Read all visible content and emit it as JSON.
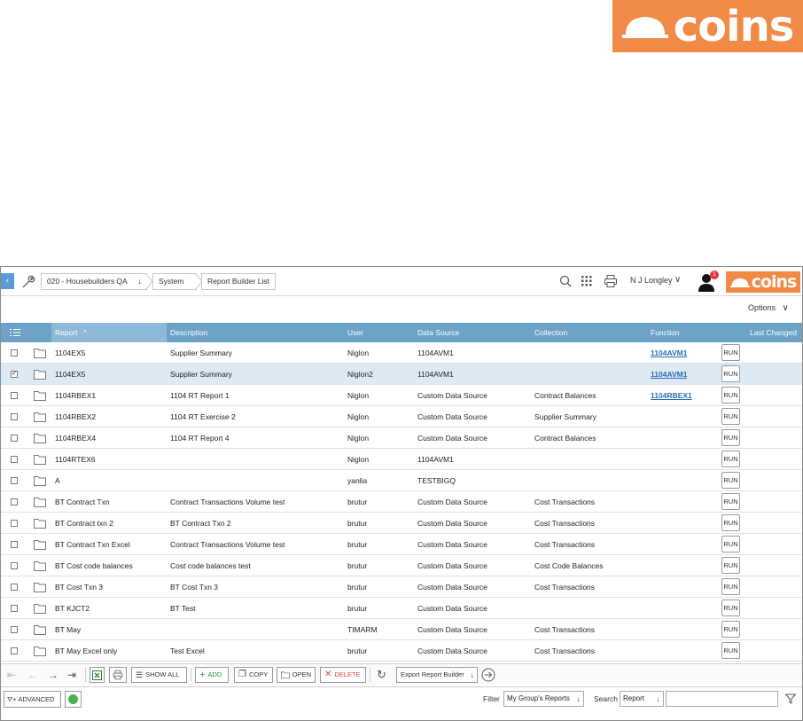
{
  "colors": {
    "brand": "#f08a46",
    "header_bar": "#6ea3c9",
    "selected_row": "#dde9f3",
    "link": "#2a6fb0"
  },
  "brand": {
    "logo_text": "coins"
  },
  "header": {
    "breadcrumbs": [
      "020 - Housebuilders QA",
      "System",
      "Report Builder List"
    ],
    "user_name": "N J Longley",
    "notification_count": "1",
    "icons": [
      "wrench-icon",
      "search-icon",
      "grid-icon",
      "print-icon",
      "user-icon"
    ]
  },
  "options_label": "Options",
  "table": {
    "columns": [
      "Report",
      "Description",
      "User",
      "Data Source",
      "Collection",
      "Function",
      "Last Changed"
    ],
    "sort_indicator": "^",
    "rows": [
      {
        "checked": false,
        "report": "1104EX5",
        "description": "Supplier Summary",
        "user": "Niglon",
        "data_source": "1104AVM1",
        "collection": "",
        "function": "1104AVM1",
        "last_changed": ""
      },
      {
        "checked": true,
        "report": "1104EX5",
        "description": "Supplier Summary",
        "user": "Niglon2",
        "data_source": "1104AVM1",
        "collection": "",
        "function": "1104AVM1",
        "last_changed": ""
      },
      {
        "checked": false,
        "report": "1104RBEX1",
        "description": "1104 RT Report 1",
        "user": "Niglon",
        "data_source": "Custom Data Source",
        "collection": "Contract Balances",
        "function": "1104RBEX1",
        "last_changed": ""
      },
      {
        "checked": false,
        "report": "1104RBEX2",
        "description": "1104 RT Exercise 2",
        "user": "Niglon",
        "data_source": "Custom Data Source",
        "collection": "Supplier Summary",
        "function": "",
        "last_changed": ""
      },
      {
        "checked": false,
        "report": "1104RBEX4",
        "description": "1104 RT Report 4",
        "user": "Niglon",
        "data_source": "Custom Data Source",
        "collection": "Contract Balances",
        "function": "",
        "last_changed": ""
      },
      {
        "checked": false,
        "report": "1104RTEX6",
        "description": "",
        "user": "Niglon",
        "data_source": "1104AVM1",
        "collection": "",
        "function": "",
        "last_changed": ""
      },
      {
        "checked": false,
        "report": "A",
        "description": "",
        "user": "yanlia",
        "data_source": "TESTBIGQ",
        "collection": "",
        "function": "",
        "last_changed": ""
      },
      {
        "checked": false,
        "report": "BT Contract Txn",
        "description": "Contract Transactions Volume test",
        "user": "brutur",
        "data_source": "Custom Data Source",
        "collection": "Cost Transactions",
        "function": "",
        "last_changed": ""
      },
      {
        "checked": false,
        "report": "BT Contract txn 2",
        "description": "BT Contract Txn 2",
        "user": "brutur",
        "data_source": "Custom Data Source",
        "collection": "Cost Transactions",
        "function": "",
        "last_changed": ""
      },
      {
        "checked": false,
        "report": "BT Contract Txn Excel",
        "description": "Contract Transactions Volume test",
        "user": "brutur",
        "data_source": "Custom Data Source",
        "collection": "Cost Transactions",
        "function": "",
        "last_changed": ""
      },
      {
        "checked": false,
        "report": "BT Cost code balances",
        "description": "Cost code balances test",
        "user": "brutur",
        "data_source": "Custom Data Source",
        "collection": "Cost Code Balances",
        "function": "",
        "last_changed": ""
      },
      {
        "checked": false,
        "report": "BT Cost Txn 3",
        "description": "BT Cost Txn 3",
        "user": "brutur",
        "data_source": "Custom Data Source",
        "collection": "Cost Transactions",
        "function": "",
        "last_changed": ""
      },
      {
        "checked": false,
        "report": "BT KJCT2",
        "description": "BT Test",
        "user": "brutur",
        "data_source": "Custom Data Source",
        "collection": "",
        "function": "",
        "last_changed": ""
      },
      {
        "checked": false,
        "report": "BT May",
        "description": "",
        "user": "TIMARM",
        "data_source": "Custom Data Source",
        "collection": "Cost Transactions",
        "function": "",
        "last_changed": ""
      },
      {
        "checked": false,
        "report": "BT May Excel only",
        "description": "Test Excel",
        "user": "brutur",
        "data_source": "Custom Data Source",
        "collection": "Cost Transactions",
        "function": "",
        "last_changed": ""
      }
    ],
    "run_label": "RUN"
  },
  "toolbar": {
    "show_all": "SHOW ALL",
    "add": "ADD",
    "copy": "COPY",
    "open": "OPEN",
    "delete": "DELETE",
    "export_select": "Export Report Builder"
  },
  "filterbar": {
    "advanced": "ADVANCED",
    "filter_label": "Filter",
    "filter_value": "My Group's Reports",
    "search_label": "Search",
    "search_value": "Report"
  }
}
